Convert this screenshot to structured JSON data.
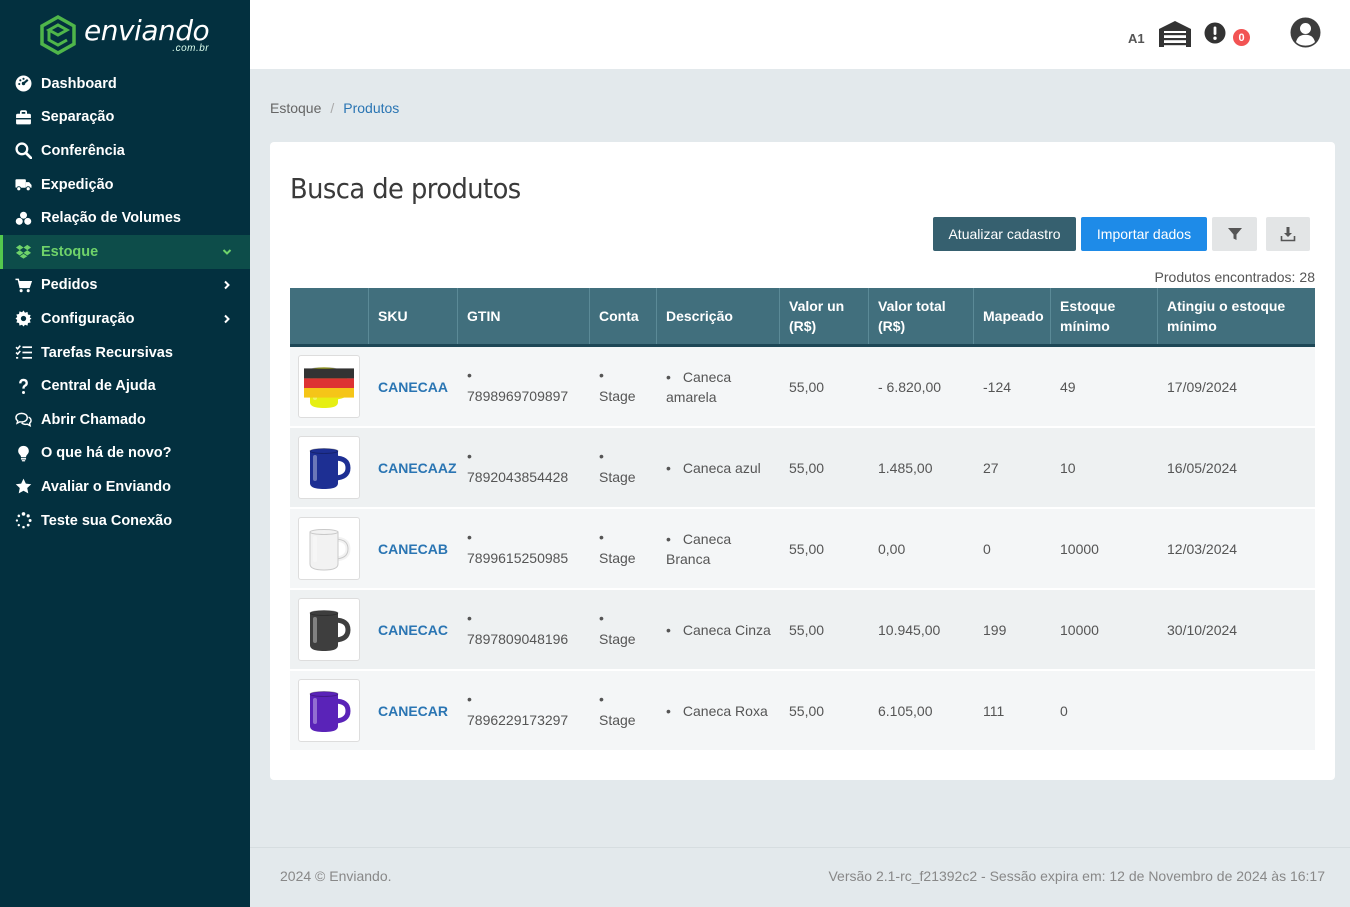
{
  "brand": {
    "name": "enviando",
    "sub": ".com.br",
    "green": "#4fb54a"
  },
  "sidebar": {
    "items": [
      {
        "label": "Dashboard",
        "icon": "dashboard-icon"
      },
      {
        "label": "Separação",
        "icon": "briefcase-icon"
      },
      {
        "label": "Conferência",
        "icon": "search-icon"
      },
      {
        "label": "Expedição",
        "icon": "truck-icon"
      },
      {
        "label": "Relação de Volumes",
        "icon": "boxes-icon"
      },
      {
        "label": "Estoque",
        "icon": "dropbox-icon",
        "active": true,
        "chevron": "down"
      },
      {
        "label": "Pedidos",
        "icon": "cart-icon",
        "chevron": "right"
      },
      {
        "label": "Configuração",
        "icon": "gear-icon",
        "chevron": "right"
      },
      {
        "label": "Tarefas Recursivas",
        "icon": "tasks-icon"
      },
      {
        "label": "Central de Ajuda",
        "icon": "question-icon"
      },
      {
        "label": "Abrir Chamado",
        "icon": "comments-icon"
      },
      {
        "label": "O que há de novo?",
        "icon": "lightbulb-icon"
      },
      {
        "label": "Avaliar o Enviando",
        "icon": "star-icon"
      },
      {
        "label": "Teste sua Conexão",
        "icon": "spinner-icon"
      }
    ]
  },
  "topbar": {
    "warehouse_code": "A1",
    "alerts_count": "0"
  },
  "breadcrumb": {
    "parent": "Estoque",
    "current": "Produtos"
  },
  "page": {
    "title": "Busca de produtos",
    "btn_update": "Atualizar cadastro",
    "btn_import": "Importar dados",
    "found_label": "Produtos encontrados:",
    "found_count": "28"
  },
  "table": {
    "headers": [
      "",
      "SKU",
      "GTIN",
      "Conta",
      "Descrição",
      "Valor un (R$)",
      "Valor total (R$)",
      "Mapeado",
      "Estoque mínimo",
      "Atingiu o estoque mínimo"
    ],
    "rows": [
      {
        "color": "#e6ef13",
        "sku": "CANECAA",
        "gtin": "7898969709897",
        "conta": "Stage",
        "desc": "Caneca amarela",
        "valor_un": "55,00",
        "valor_total": "- 6.820,00",
        "mapeado": "-124",
        "estoque_min": "49",
        "atingiu": "17/09/2024",
        "flag": true
      },
      {
        "color": "#1d2f93",
        "sku": "CANECAAZ",
        "gtin": "7892043854428",
        "conta": "Stage",
        "desc": "Caneca azul",
        "valor_un": "55,00",
        "valor_total": "1.485,00",
        "mapeado": "27",
        "estoque_min": "10",
        "atingiu": "16/05/2024"
      },
      {
        "color": "#f2f2f2",
        "sku": "CANECAB",
        "gtin": "7899615250985",
        "conta": "Stage",
        "desc": "Caneca Branca",
        "valor_un": "55,00",
        "valor_total": "0,00",
        "mapeado": "0",
        "estoque_min": "10000",
        "atingiu": "12/03/2024"
      },
      {
        "color": "#3e3e3e",
        "sku": "CANECAC",
        "gtin": "7897809048196",
        "conta": "Stage",
        "desc": "Caneca Cinza",
        "valor_un": "55,00",
        "valor_total": "10.945,00",
        "mapeado": "199",
        "estoque_min": "10000",
        "atingiu": "30/10/2024"
      },
      {
        "color": "#5a23b8",
        "sku": "CANECAR",
        "gtin": "7896229173297",
        "conta": "Stage",
        "desc": "Caneca Roxa",
        "valor_un": "55,00",
        "valor_total": "6.105,00",
        "mapeado": "111",
        "estoque_min": "0",
        "atingiu": ""
      }
    ]
  },
  "footer": {
    "left": "2024 © Enviando.",
    "right": "Versão 2.1-rc_f21392c2 - Sessão expira em: 12 de Novembro de 2024 às 16:17"
  }
}
